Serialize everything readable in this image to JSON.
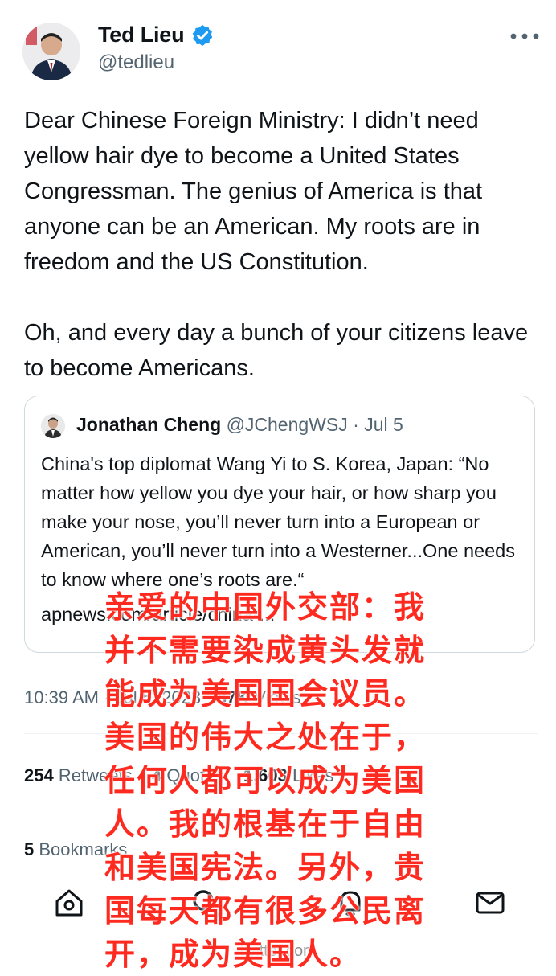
{
  "author": {
    "display_name": "Ted Lieu",
    "handle": "@tedlieu",
    "avatar_icon": "person-avatar",
    "verified_icon": "verified-badge-icon",
    "verified_color": "#1d9bf0"
  },
  "tweet": {
    "text": "Dear Chinese Foreign Ministry: I didn’t need yellow hair dye to become a United States Congressman. The genius of America is that anyone can be an American. My roots are in freedom and the US Constitution.\n\nOh, and every day a bunch of your citizens leave to become Americans."
  },
  "quote": {
    "name": "Jonathan Cheng",
    "handle": "@JChengWSJ",
    "separator": "·",
    "date": "Jul 5",
    "text": "China's top diplomat Wang Yi to S. Korea, Japan: “No matter how yellow you dye your hair, or how sharp you make your nose, you’ll never turn into a European or American, you’ll never turn into a Westerner...One needs to know where one’s roots are.“",
    "link": "apnews.com/article/china-..."
  },
  "meta": {
    "time": "10:39 AM",
    "separator": "·",
    "date": "Jul 5, 2023",
    "views_count": "87K",
    "views_label": "Views"
  },
  "stats": {
    "retweets_count": "254",
    "retweets_label": "Retweets",
    "quotes_count": "4",
    "quotes_label": "Quotes",
    "likes_count": "1,603",
    "likes_label": "Likes",
    "bookmarks_count": "5",
    "bookmarks_label": "Bookmarks"
  },
  "nav": {
    "items": [
      "home-icon",
      "search-icon",
      "notifications-icon",
      "messages-icon"
    ]
  },
  "browser": {
    "url": "twitter.com"
  },
  "overlay": {
    "text": "亲爱的中国外交部：我\n并不需要染成黄头发就\n能成为美国国会议员。\n美国的伟大之处在于，\n任何人都可以成为美国\n人。我的根基在于自由\n和美国宪法。另外，贵\n国每天都有很多公民离\n开，成为美国人。",
    "color": "#ff2a1f"
  }
}
